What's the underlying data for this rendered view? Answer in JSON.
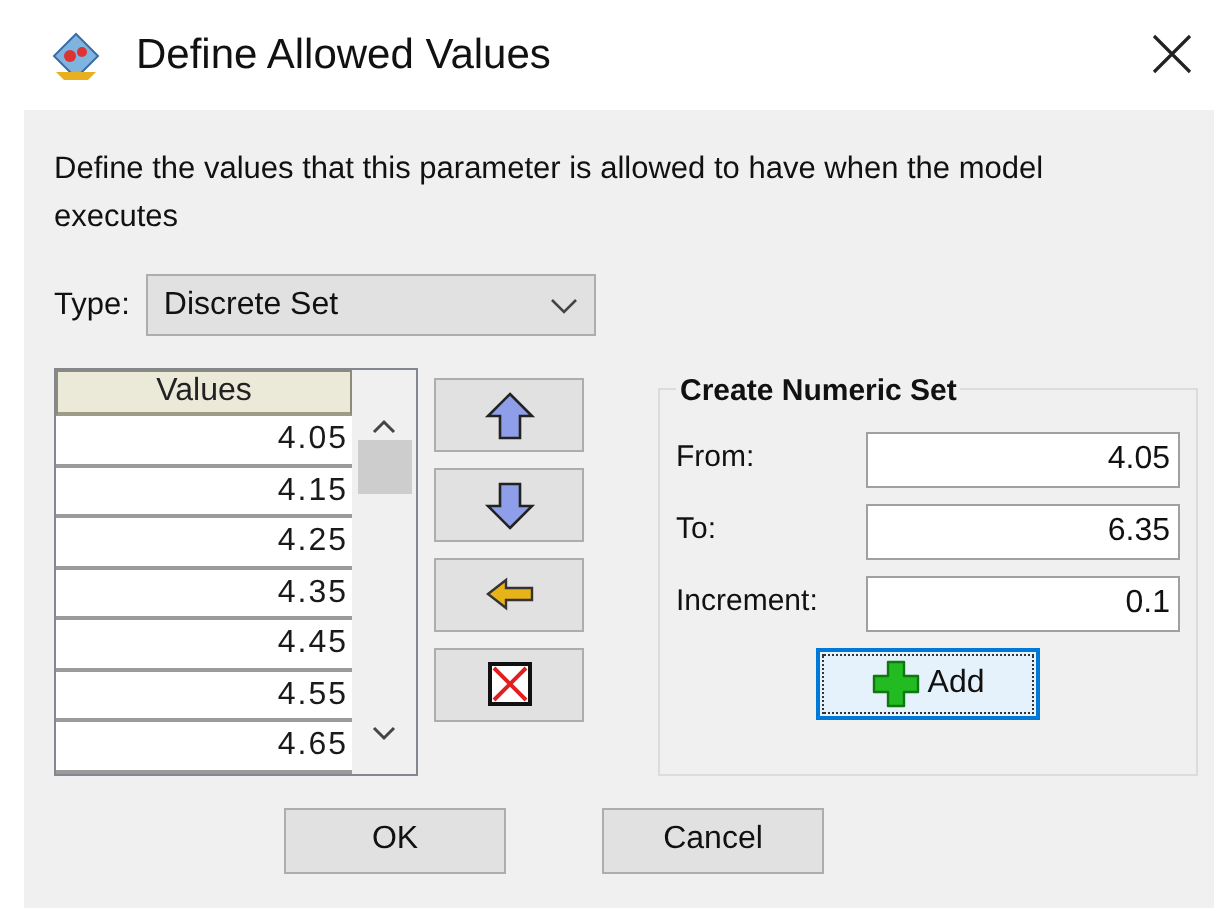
{
  "window": {
    "title": "Define Allowed Values"
  },
  "description": "Define the values that this parameter is allowed to have when the model executes",
  "type_field": {
    "label": "Type:",
    "value": "Discrete Set"
  },
  "values_table": {
    "column": "Values",
    "rows": [
      {
        "value": "4.05"
      },
      {
        "value": "4.15"
      },
      {
        "value": "4.25"
      },
      {
        "value": "4.35"
      },
      {
        "value": "4.45"
      },
      {
        "value": "4.55"
      },
      {
        "value": "4.65"
      }
    ]
  },
  "numeric_set": {
    "title": "Create Numeric Set",
    "fields": [
      {
        "label": "From:",
        "value": "4.05"
      },
      {
        "label": "To:",
        "value": "6.35"
      },
      {
        "label": "Increment:",
        "value": "0.1"
      }
    ],
    "add_button": {
      "label": "Add",
      "focused": true
    }
  },
  "buttons": [
    {
      "label": "OK"
    },
    {
      "label": "Cancel"
    }
  ]
}
